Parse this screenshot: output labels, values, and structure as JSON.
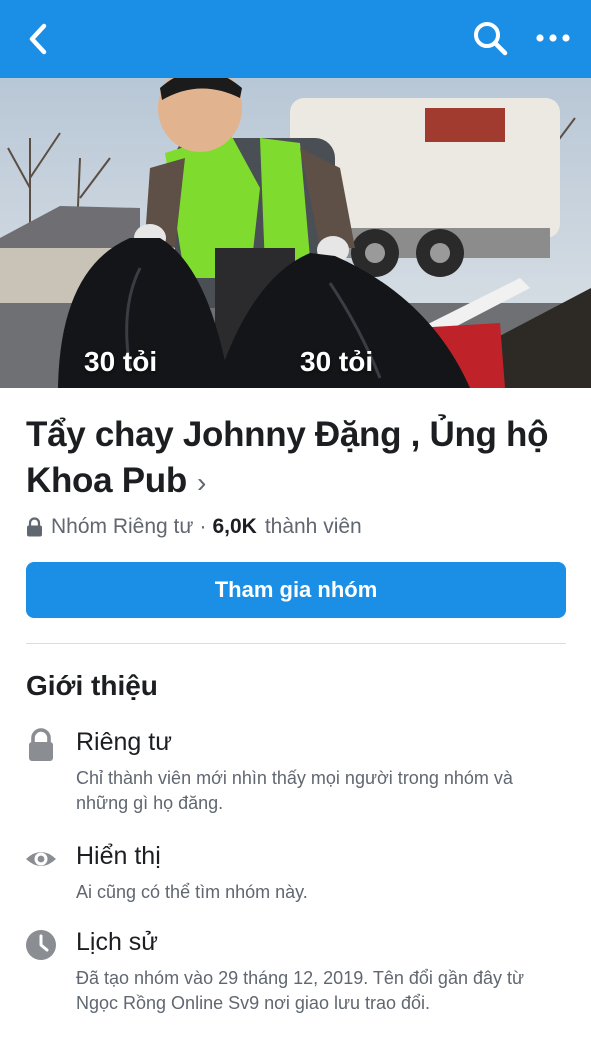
{
  "nav": {
    "back_icon": "chevron-left-icon",
    "search_icon": "search-icon",
    "more_icon": "more-horizontal-icon",
    "bar_color": "#1b8fe6"
  },
  "cover": {
    "labels": [
      "30 tỏi",
      "30 tỏi"
    ]
  },
  "group": {
    "name": "Tẩy chay Johnny Đặng , Ủng hộ Khoa Pub",
    "privacy": "Nhóm Riêng tư",
    "separator": "·",
    "member_count": "6,0K",
    "member_label": "thành viên"
  },
  "join_button": {
    "label": "Tham gia nhóm",
    "color": "#1b8fe6"
  },
  "about": {
    "title": "Giới thiệu",
    "items": [
      {
        "icon": "lock-icon",
        "label": "Riêng tư",
        "description": "Chỉ thành viên mới nhìn thấy mọi người trong nhóm và những gì họ đăng."
      },
      {
        "icon": "eye-icon",
        "label": "Hiển thị",
        "description": "Ai cũng có thể tìm nhóm này."
      },
      {
        "icon": "clock-icon",
        "label": "Lịch sử",
        "description": "Đã tạo nhóm vào 29 tháng 12, 2019. Tên đổi gần đây từ Ngọc Rồng Online Sv9 nơi giao lưu trao đổi."
      }
    ]
  }
}
